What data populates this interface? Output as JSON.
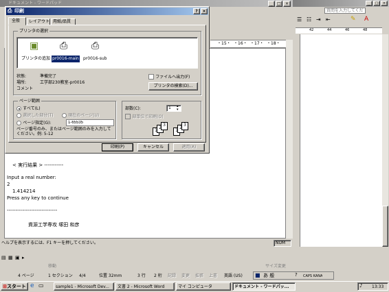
{
  "word": {
    "title": "ドキュメント - ワードパッド",
    "menu_placeholder": "質問を入力してください",
    "ruler_marks": [
      "・15・",
      "・16・",
      "・17・",
      "・18・"
    ],
    "right_ruler": [
      "42",
      "44",
      "46",
      "48"
    ],
    "doc_lines": [
      "< 実行結果 > -----------",
      "Input a real number:",
      "2",
      "1.414214",
      "Press any key to continue",
      "-----------------------------",
      "資源工学専攻 塚田 和彦"
    ],
    "status_help": "ヘルプを表示するには、F1 キーを押してください。",
    "status_num": "NUM",
    "status": {
      "page": "4 ページ",
      "section": "1 セクション",
      "pages": "4/4",
      "position": "位置 32mm",
      "line": "3 行",
      "col": "2 桁",
      "rec": "記録",
      "trk": "変更",
      "ext": "拡張",
      "ovr": "上書",
      "lang": "英語 (US)"
    },
    "draw_bar": [
      "移動",
      "サイズ変更"
    ]
  },
  "dialog": {
    "title": "印刷",
    "help_btn": "?",
    "close_btn": "×",
    "tabs": [
      "全般",
      "レイアウト",
      "用紙/品質"
    ],
    "printer_group": "プリンタの選択",
    "printers": [
      "プリンタの追加",
      "pr0016-main",
      "pr0016-sub"
    ],
    "state_label": "状態:",
    "state_value": "準備完了",
    "location_label": "場所:",
    "location_value": "工学部230教室-pr0016",
    "comment_label": "コメント",
    "file_output": "ファイルへ出力(F)",
    "find_printer": "プリンタの検索(D)...",
    "range_group": "ページ範囲",
    "all": "すべて(L)",
    "selection": "選択した部分(T)",
    "current_page": "現在のページ(U)",
    "pages_label": "ページ指定(G):",
    "pages_value": "1-65535",
    "pages_hint": "ページ番号のみ、またはページ範囲のみを入力してください。例: 5-12",
    "copies_label": "部数(C):",
    "copies_value": "1",
    "collate": "部単位で印刷(O)",
    "print_btn": "印刷(P)",
    "cancel_btn": "キャンセル",
    "apply_btn": "適用(A)"
  },
  "taskbar": {
    "start": "スタート",
    "items": [
      "sample1 - Microsoft Dev...",
      "文書 2 - Microsoft Word",
      "マイ コンピュータ",
      "ドキュメント - ワードパッ..."
    ],
    "clock": "13:33",
    "ime_label": "あ 般",
    "caps": "CAPS KANA"
  }
}
